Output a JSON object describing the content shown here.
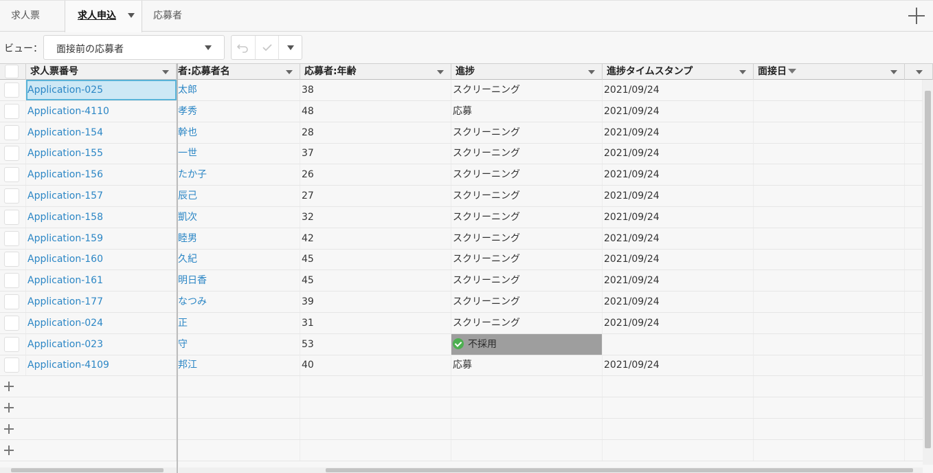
{
  "tabs": [
    {
      "label": "求人票",
      "active": false
    },
    {
      "label": "求人申込",
      "active": true
    },
    {
      "label": "応募者",
      "active": false
    }
  ],
  "toolbar": {
    "view_label": "ビュー：",
    "view_value": "面接前の応募者"
  },
  "grid": {
    "columns": [
      "求人票番号",
      "者:応募者名",
      "応募者:年齢",
      "進捗",
      "進捗タイムスタンプ",
      "面接日",
      ""
    ],
    "rows": [
      {
        "id": "Application-025",
        "name": "太郎",
        "age": "38",
        "progress": "スクリーニング",
        "timestamp": "2021/09/24"
      },
      {
        "id": "Application-4110",
        "name": "孝秀",
        "age": "48",
        "progress": "応募",
        "timestamp": "2021/09/24"
      },
      {
        "id": "Application-154",
        "name": "幹也",
        "age": "28",
        "progress": "スクリーニング",
        "timestamp": "2021/09/24"
      },
      {
        "id": "Application-155",
        "name": "一世",
        "age": "37",
        "progress": "スクリーニング",
        "timestamp": "2021/09/24"
      },
      {
        "id": "Application-156",
        "name": "たか子",
        "age": "26",
        "progress": "スクリーニング",
        "timestamp": "2021/09/24"
      },
      {
        "id": "Application-157",
        "name": "辰己",
        "age": "27",
        "progress": "スクリーニング",
        "timestamp": "2021/09/24"
      },
      {
        "id": "Application-158",
        "name": "凱次",
        "age": "32",
        "progress": "スクリーニング",
        "timestamp": "2021/09/24"
      },
      {
        "id": "Application-159",
        "name": "睦男",
        "age": "42",
        "progress": "スクリーニング",
        "timestamp": "2021/09/24"
      },
      {
        "id": "Application-160",
        "name": "久紀",
        "age": "45",
        "progress": "スクリーニング",
        "timestamp": "2021/09/24"
      },
      {
        "id": "Application-161",
        "name": "明日香",
        "age": "45",
        "progress": "スクリーニング",
        "timestamp": "2021/09/24"
      },
      {
        "id": "Application-177",
        "name": "なつみ",
        "age": "39",
        "progress": "スクリーニング",
        "timestamp": "2021/09/24"
      },
      {
        "id": "Application-024",
        "name": "正",
        "age": "31",
        "progress": "スクリーニング",
        "timestamp": "2021/09/24"
      },
      {
        "id": "Application-023",
        "name": "守",
        "age": "53",
        "progress": "不採用",
        "timestamp": ""
      },
      {
        "id": "Application-4109",
        "name": "邦江",
        "age": "40",
        "progress": "応募",
        "timestamp": "2021/09/24"
      }
    ]
  }
}
